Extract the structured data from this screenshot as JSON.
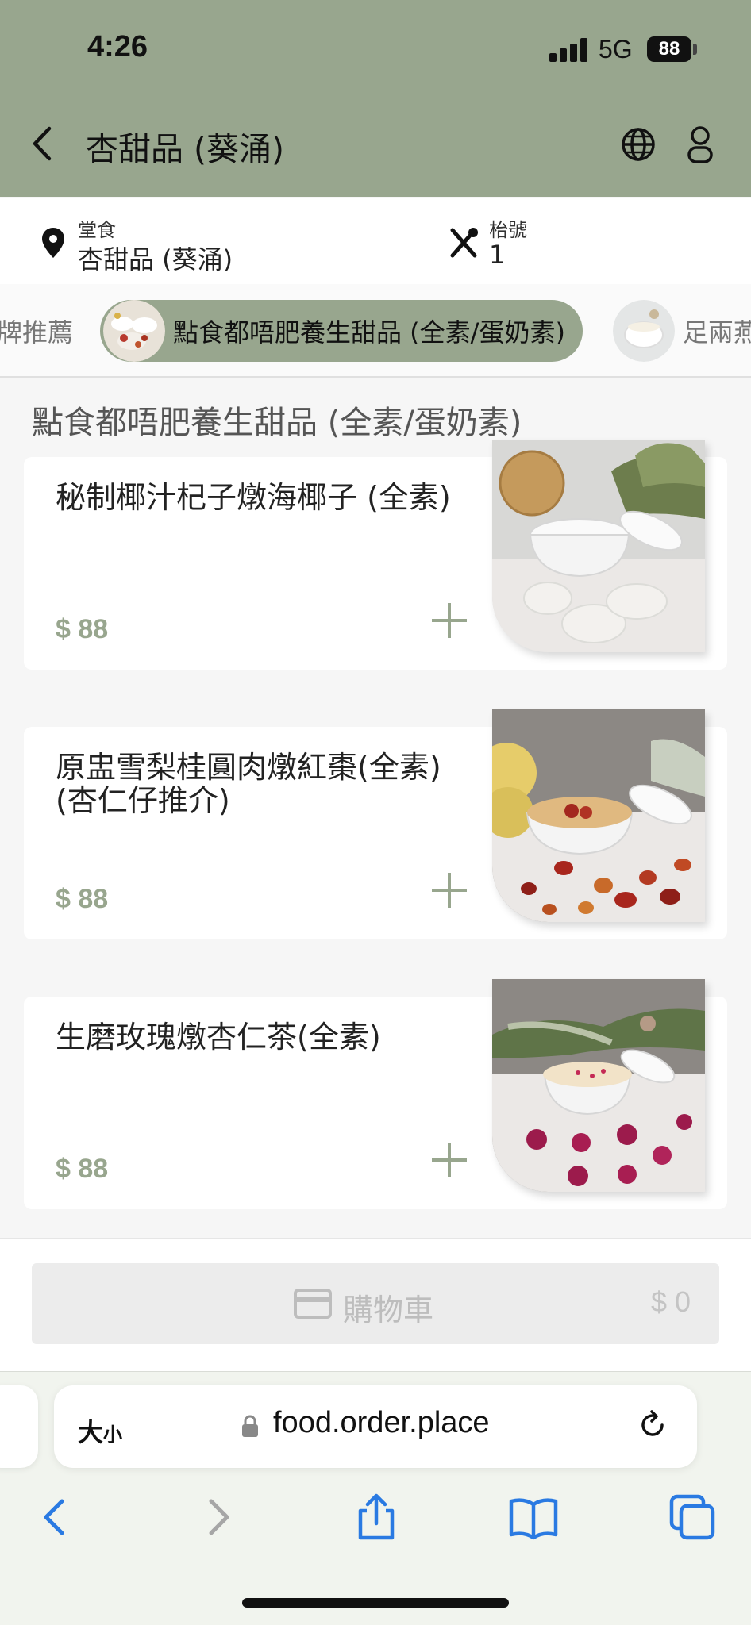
{
  "status_bar": {
    "time": "4:26",
    "network": "5G",
    "battery": "88"
  },
  "header": {
    "title": "杏甜品 (葵涌)",
    "colors": {
      "header_bg": "#98a68e"
    }
  },
  "info": {
    "dine_label": "堂食",
    "dine_value": "杏甜品 (葵涌)",
    "table_label": "枱號",
    "table_value": "1"
  },
  "categories": [
    {
      "label": "牌推薦",
      "active": false
    },
    {
      "label": "點食都唔肥養生甜品 (全素/蛋奶素)",
      "active": true
    },
    {
      "label": "足兩燕",
      "active": false
    }
  ],
  "section_title": "點食都唔肥養生甜品 (全素/蛋奶素)",
  "products": [
    {
      "name": "秘制椰汁杞子燉海椰子 (全素)",
      "price": "$ 88"
    },
    {
      "name": "原盅雪梨桂圓肉燉紅棗(全素) (杏仁仔推介)",
      "price": "$ 88"
    },
    {
      "name": "生磨玫瑰燉杏仁茶(全素)",
      "price": "$ 88"
    }
  ],
  "cart": {
    "label": "購物車",
    "total": "$ 0",
    "icon": "credit-card-icon"
  },
  "browser": {
    "aa_big": "大",
    "aa_small": "小",
    "url": "food.order.place",
    "nav_icons": [
      "back-icon",
      "forward-icon",
      "share-icon",
      "bookmarks-icon",
      "tabs-icon"
    ]
  }
}
